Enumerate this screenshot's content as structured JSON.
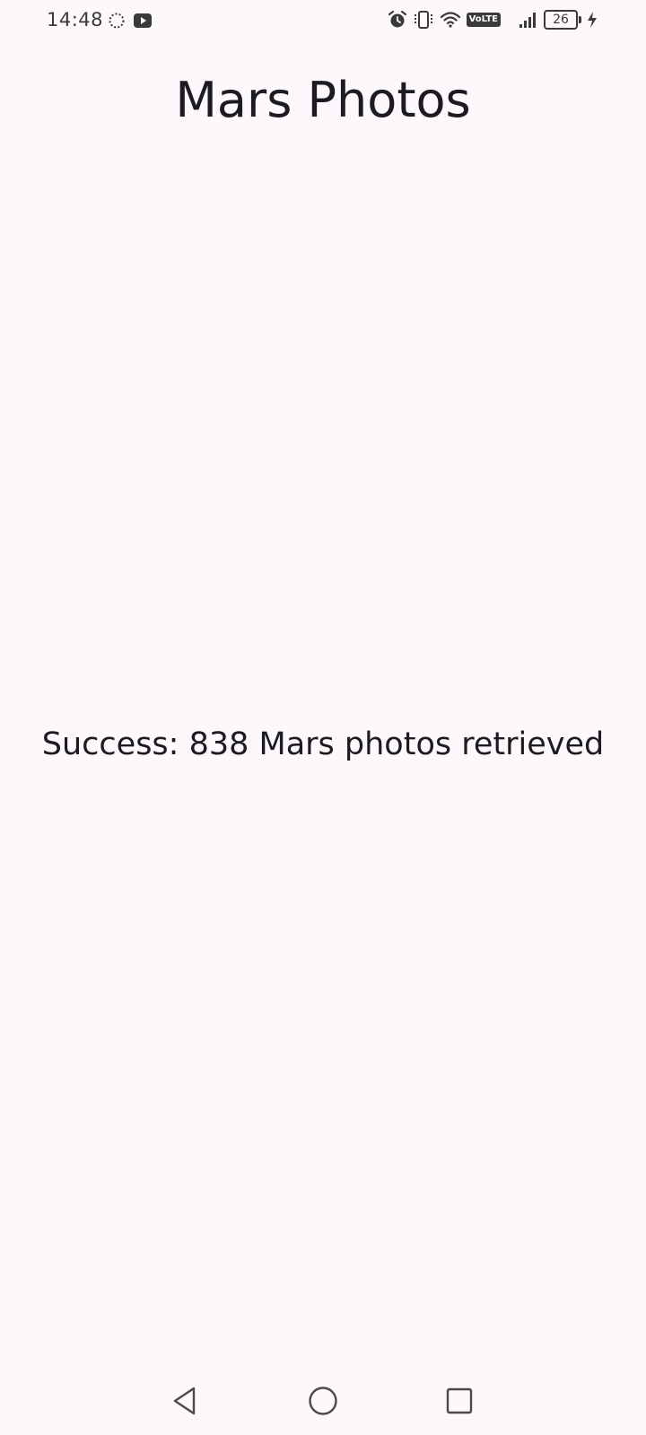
{
  "status_bar": {
    "time": "14:48",
    "battery_level": "26",
    "network_label": "VoLTE",
    "icons": [
      "sync-icon",
      "youtube-icon",
      "alarm-icon",
      "vibrate-icon",
      "wifi-icon",
      "volte-icon",
      "signal-icon",
      "battery-icon",
      "charging-icon"
    ]
  },
  "app": {
    "title": "Mars Photos",
    "result_message": "Success: 838 Mars photos retrieved"
  },
  "nav_bar": {
    "icons": [
      "back-icon",
      "home-icon",
      "recents-icon"
    ]
  },
  "colors": {
    "background": "#fdf8fc",
    "text": "#1c1b1f",
    "status_icons": "#3a3a3a"
  }
}
